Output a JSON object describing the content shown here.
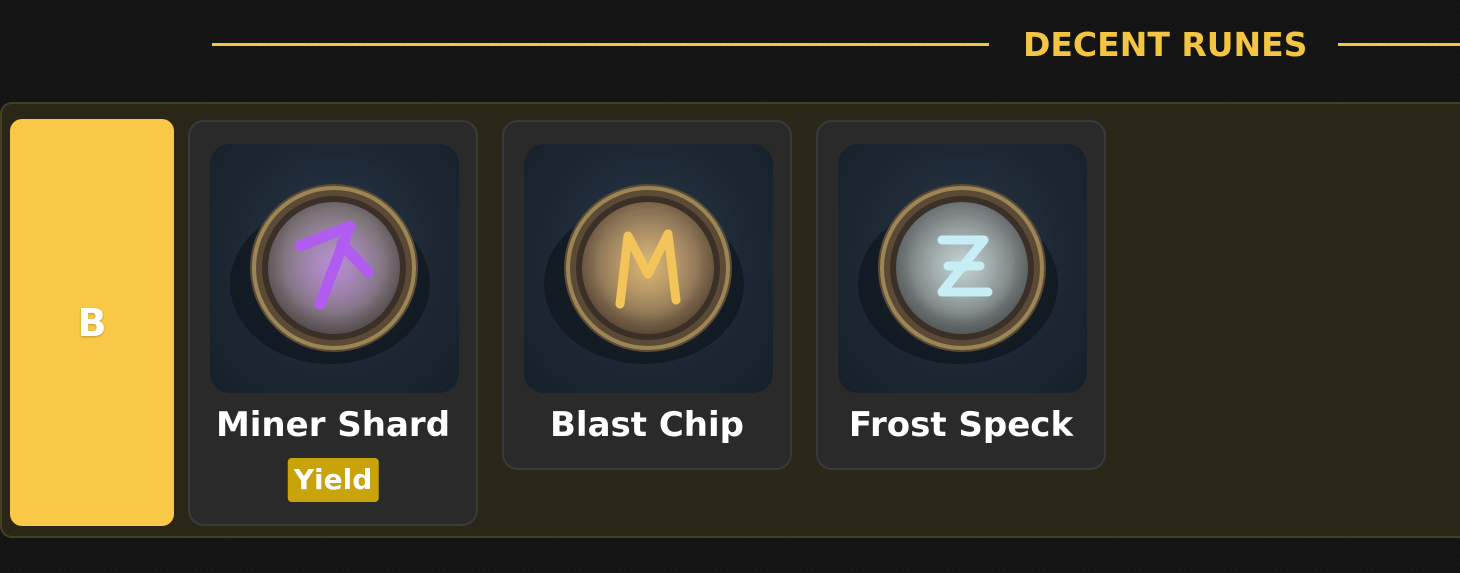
{
  "section": {
    "title": "DECENT RUNES"
  },
  "tier": {
    "label": "B",
    "color": "#f9c847"
  },
  "runes": [
    {
      "name": "Miner Shard",
      "tag": "Yield",
      "icon": "purple-arrow-rune-icon",
      "glyph_color": "#b05cf0"
    },
    {
      "name": "Blast Chip",
      "tag": null,
      "icon": "orange-m-rune-icon",
      "glyph_color": "#f2c45a"
    },
    {
      "name": "Frost Speck",
      "tag": null,
      "icon": "ice-z-rune-icon",
      "glyph_color": "#c8eef5"
    }
  ],
  "colors": {
    "accent": "#f4c542",
    "tag_bg": "#c9a30a",
    "card_bg": "#2a2a2a",
    "row_bg": "#2b2718"
  }
}
